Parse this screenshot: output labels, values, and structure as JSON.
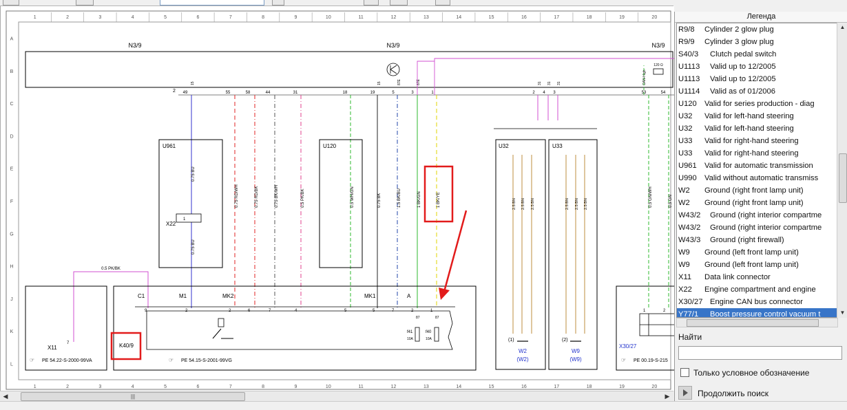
{
  "toolbar": {
    "search_value": ""
  },
  "grid": {
    "columns": [
      "1",
      "2",
      "3",
      "4",
      "5",
      "6",
      "7",
      "8",
      "9",
      "10",
      "11",
      "12",
      "13",
      "14",
      "15",
      "16",
      "17",
      "18",
      "19",
      "20"
    ],
    "rows": [
      "A",
      "B",
      "C",
      "D",
      "E",
      "F",
      "G",
      "H",
      "J",
      "K",
      "L"
    ]
  },
  "diagram": {
    "top_module_labels": [
      "N3/9",
      "N3/9",
      "N3/9"
    ],
    "bus_pins": [
      "2",
      "49",
      "55",
      "58",
      "44",
      "31",
      "18",
      "19",
      "5",
      "3",
      "1",
      "2",
      "4",
      "3",
      "53",
      "54"
    ],
    "bus_small_labels": [
      "15",
      "15",
      "87E",
      "87E",
      "31",
      "31",
      "31",
      "CAN-High",
      "120 Ω"
    ],
    "boxes": {
      "u961": "U961",
      "u120": "U120",
      "u32": "U32",
      "u33": "U33",
      "x22": "X22",
      "x22_pin": "1"
    },
    "wire_labels": [
      "0.75 BU",
      "0.75 BU",
      "0.75 RD/WH",
      "0.75 RD/BK",
      "0.75 BK/WH",
      "0.5 PK/BK",
      "0.5 WH/GN",
      "0.75 BK",
      "1.5 BK/BU",
      "1 BK/GN",
      "1 BK/YE",
      "0.5 GN/WH",
      "0.5 GN",
      "0.5 PK/BK"
    ],
    "u32_wires": [
      "2.5 BN",
      "2.5 BN",
      "2.5 BN"
    ],
    "u33_wires": [
      "2.5 BN",
      "2.5 BN",
      "2.5 BN"
    ],
    "connectors": [
      "C1",
      "M1",
      "MK2",
      "MK1",
      "A"
    ],
    "connector_pins": [
      "9",
      "2",
      "2",
      "6",
      "7",
      "4",
      "5",
      "5",
      "7",
      "2",
      "1",
      "1",
      "2"
    ],
    "fuses": {
      "f41": "f41",
      "f40": "f40",
      "f41_rating": "10A",
      "f40_rating": "10A",
      "pin_87a": "87",
      "pin_87b": "87"
    },
    "components": {
      "x11": "X11",
      "x11_pin": "7",
      "k40": "K40/9",
      "x30": "X30/27",
      "w2": "W2",
      "w2_sub": "(W2)",
      "w2_num": "(1)",
      "w9": "W9",
      "w9_sub": "(W9)",
      "w9_num": "(2)"
    },
    "references": {
      "x11_ref": "PE 54.22-S-2000-99VA",
      "k40_ref": "PE 54.15-S-2001-99VG",
      "x30_ref": "PE 00.19-S-215"
    }
  },
  "legend": {
    "header": "Легенда",
    "items": [
      {
        "code": "R9/8",
        "desc": "Cylinder 2 glow plug"
      },
      {
        "code": "R9/9",
        "desc": "Cylinder 3 glow plug"
      },
      {
        "code": "S40/3",
        "desc": "Clutch pedal switch"
      },
      {
        "code": "U1113",
        "desc": "Valid up to 12/2005"
      },
      {
        "code": "U1113",
        "desc": "Valid up to 12/2005"
      },
      {
        "code": "U1114",
        "desc": "Valid as of 01/2006"
      },
      {
        "code": "U120",
        "desc": "Valid for series production - diag"
      },
      {
        "code": "U32",
        "desc": "Valid for left-hand steering"
      },
      {
        "code": "U32",
        "desc": "Valid for left-hand steering"
      },
      {
        "code": "U33",
        "desc": "Valid for right-hand steering"
      },
      {
        "code": "U33",
        "desc": "Valid for right-hand steering"
      },
      {
        "code": "U961",
        "desc": "Valid for automatic transmission"
      },
      {
        "code": "U990",
        "desc": "Valid without automatic transmiss"
      },
      {
        "code": "W2",
        "desc": "Ground (right front lamp unit)"
      },
      {
        "code": "W2",
        "desc": "Ground (right front lamp unit)"
      },
      {
        "code": "W43/2",
        "desc": "Ground (right interior compartme"
      },
      {
        "code": "W43/2",
        "desc": "Ground (right interior compartme"
      },
      {
        "code": "W43/3",
        "desc": "Ground (right firewall)"
      },
      {
        "code": "W9",
        "desc": "Ground (left front lamp unit)"
      },
      {
        "code": "W9",
        "desc": "Ground (left front lamp unit)"
      },
      {
        "code": "X11",
        "desc": "Data link connector"
      },
      {
        "code": "X22",
        "desc": "Engine compartment and engine"
      },
      {
        "code": "X30/27",
        "desc": "Engine CAN bus connector"
      },
      {
        "code": "Y77/1",
        "desc": "Boost pressure control vacuum t"
      }
    ],
    "selected_index": 23,
    "find_label": "Найти",
    "find_value": "",
    "checkbox_label": "Только условное обозначение",
    "continue_label": "Продолжить поиск"
  }
}
